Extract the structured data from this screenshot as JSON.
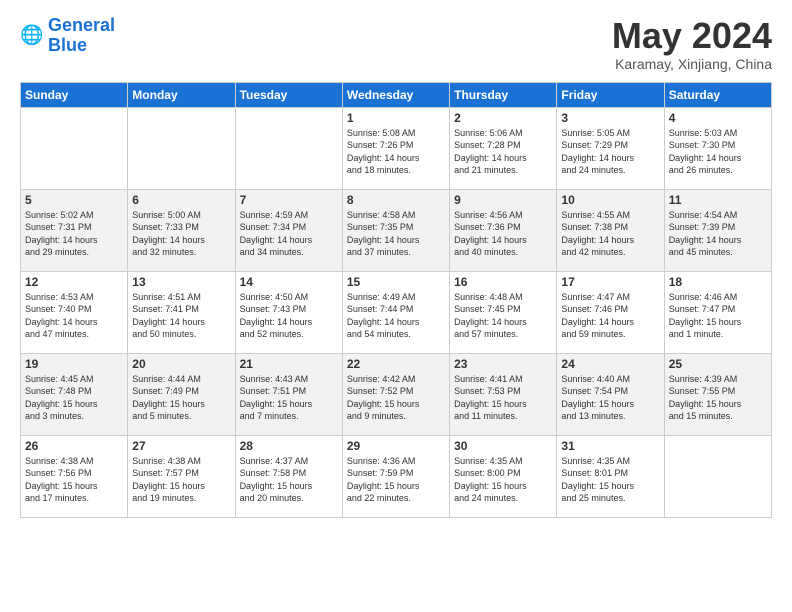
{
  "header": {
    "logo_text1": "General",
    "logo_text2": "Blue",
    "month": "May 2024",
    "location": "Karamay, Xinjiang, China"
  },
  "weekdays": [
    "Sunday",
    "Monday",
    "Tuesday",
    "Wednesday",
    "Thursday",
    "Friday",
    "Saturday"
  ],
  "weeks": [
    [
      {
        "day": "",
        "info": ""
      },
      {
        "day": "",
        "info": ""
      },
      {
        "day": "",
        "info": ""
      },
      {
        "day": "1",
        "info": "Sunrise: 5:08 AM\nSunset: 7:26 PM\nDaylight: 14 hours\nand 18 minutes."
      },
      {
        "day": "2",
        "info": "Sunrise: 5:06 AM\nSunset: 7:28 PM\nDaylight: 14 hours\nand 21 minutes."
      },
      {
        "day": "3",
        "info": "Sunrise: 5:05 AM\nSunset: 7:29 PM\nDaylight: 14 hours\nand 24 minutes."
      },
      {
        "day": "4",
        "info": "Sunrise: 5:03 AM\nSunset: 7:30 PM\nDaylight: 14 hours\nand 26 minutes."
      }
    ],
    [
      {
        "day": "5",
        "info": "Sunrise: 5:02 AM\nSunset: 7:31 PM\nDaylight: 14 hours\nand 29 minutes."
      },
      {
        "day": "6",
        "info": "Sunrise: 5:00 AM\nSunset: 7:33 PM\nDaylight: 14 hours\nand 32 minutes."
      },
      {
        "day": "7",
        "info": "Sunrise: 4:59 AM\nSunset: 7:34 PM\nDaylight: 14 hours\nand 34 minutes."
      },
      {
        "day": "8",
        "info": "Sunrise: 4:58 AM\nSunset: 7:35 PM\nDaylight: 14 hours\nand 37 minutes."
      },
      {
        "day": "9",
        "info": "Sunrise: 4:56 AM\nSunset: 7:36 PM\nDaylight: 14 hours\nand 40 minutes."
      },
      {
        "day": "10",
        "info": "Sunrise: 4:55 AM\nSunset: 7:38 PM\nDaylight: 14 hours\nand 42 minutes."
      },
      {
        "day": "11",
        "info": "Sunrise: 4:54 AM\nSunset: 7:39 PM\nDaylight: 14 hours\nand 45 minutes."
      }
    ],
    [
      {
        "day": "12",
        "info": "Sunrise: 4:53 AM\nSunset: 7:40 PM\nDaylight: 14 hours\nand 47 minutes."
      },
      {
        "day": "13",
        "info": "Sunrise: 4:51 AM\nSunset: 7:41 PM\nDaylight: 14 hours\nand 50 minutes."
      },
      {
        "day": "14",
        "info": "Sunrise: 4:50 AM\nSunset: 7:43 PM\nDaylight: 14 hours\nand 52 minutes."
      },
      {
        "day": "15",
        "info": "Sunrise: 4:49 AM\nSunset: 7:44 PM\nDaylight: 14 hours\nand 54 minutes."
      },
      {
        "day": "16",
        "info": "Sunrise: 4:48 AM\nSunset: 7:45 PM\nDaylight: 14 hours\nand 57 minutes."
      },
      {
        "day": "17",
        "info": "Sunrise: 4:47 AM\nSunset: 7:46 PM\nDaylight: 14 hours\nand 59 minutes."
      },
      {
        "day": "18",
        "info": "Sunrise: 4:46 AM\nSunset: 7:47 PM\nDaylight: 15 hours\nand 1 minute."
      }
    ],
    [
      {
        "day": "19",
        "info": "Sunrise: 4:45 AM\nSunset: 7:48 PM\nDaylight: 15 hours\nand 3 minutes."
      },
      {
        "day": "20",
        "info": "Sunrise: 4:44 AM\nSunset: 7:49 PM\nDaylight: 15 hours\nand 5 minutes."
      },
      {
        "day": "21",
        "info": "Sunrise: 4:43 AM\nSunset: 7:51 PM\nDaylight: 15 hours\nand 7 minutes."
      },
      {
        "day": "22",
        "info": "Sunrise: 4:42 AM\nSunset: 7:52 PM\nDaylight: 15 hours\nand 9 minutes."
      },
      {
        "day": "23",
        "info": "Sunrise: 4:41 AM\nSunset: 7:53 PM\nDaylight: 15 hours\nand 11 minutes."
      },
      {
        "day": "24",
        "info": "Sunrise: 4:40 AM\nSunset: 7:54 PM\nDaylight: 15 hours\nand 13 minutes."
      },
      {
        "day": "25",
        "info": "Sunrise: 4:39 AM\nSunset: 7:55 PM\nDaylight: 15 hours\nand 15 minutes."
      }
    ],
    [
      {
        "day": "26",
        "info": "Sunrise: 4:38 AM\nSunset: 7:56 PM\nDaylight: 15 hours\nand 17 minutes."
      },
      {
        "day": "27",
        "info": "Sunrise: 4:38 AM\nSunset: 7:57 PM\nDaylight: 15 hours\nand 19 minutes."
      },
      {
        "day": "28",
        "info": "Sunrise: 4:37 AM\nSunset: 7:58 PM\nDaylight: 15 hours\nand 20 minutes."
      },
      {
        "day": "29",
        "info": "Sunrise: 4:36 AM\nSunset: 7:59 PM\nDaylight: 15 hours\nand 22 minutes."
      },
      {
        "day": "30",
        "info": "Sunrise: 4:35 AM\nSunset: 8:00 PM\nDaylight: 15 hours\nand 24 minutes."
      },
      {
        "day": "31",
        "info": "Sunrise: 4:35 AM\nSunset: 8:01 PM\nDaylight: 15 hours\nand 25 minutes."
      },
      {
        "day": "",
        "info": ""
      }
    ]
  ]
}
